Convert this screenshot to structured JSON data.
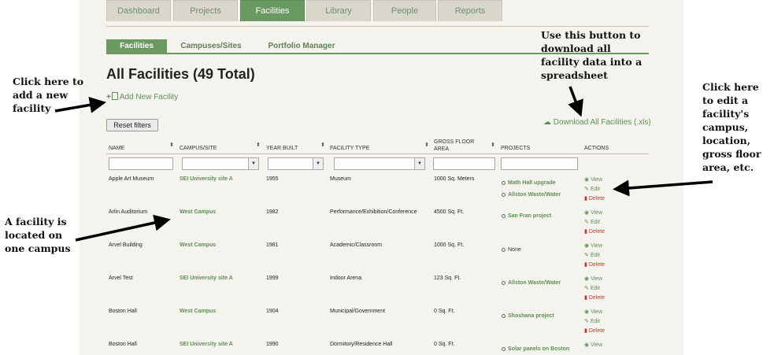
{
  "main_tabs": [
    "Dashboard",
    "Projects",
    "Facilities",
    "Library",
    "People",
    "Reports"
  ],
  "active_main_tab": "Facilities",
  "sub_tabs": [
    "Facilities",
    "Campuses/Sites",
    "Portfolio Manager"
  ],
  "page_title": "All Facilities (49 Total)",
  "add_link": "Add New Facility",
  "reset_button": "Reset filters",
  "download_link": "Download All Facilities (.xls)",
  "columns": [
    "NAME",
    "CAMPUS/SITE",
    "YEAR BUILT",
    "FACILITY TYPE",
    "GROSS FLOOR AREA",
    "PROJECTS",
    "ACTIONS"
  ],
  "actions": {
    "view": "View",
    "edit": "Edit",
    "delete": "Delete"
  },
  "rows": [
    {
      "name": "Apple Art Museum",
      "campus": "SEI University site A",
      "year": "1955",
      "type": "Museum",
      "area": "1000 Sq. Meters",
      "projects": [
        "Math Hall upgrade",
        "Allston Waste/Water"
      ]
    },
    {
      "name": "Arlin Auditorium",
      "campus": "West Campus",
      "year": "1982",
      "type": "Performance/Exhibition/Conference",
      "area": "4500 Sq. Ft.",
      "projects": [
        "San Fran project"
      ]
    },
    {
      "name": "Arvel Building",
      "campus": "West Campus",
      "year": "1981",
      "type": "Academic/Classroom",
      "area": "1000 Sq. Ft.",
      "projects": [
        "None"
      ]
    },
    {
      "name": "Arvel Test",
      "campus": "SEI University site A",
      "year": "1999",
      "type": "Indoor Arena",
      "area": "123 Sq. Ft.",
      "projects": [
        "Allston Waste/Water"
      ]
    },
    {
      "name": "Boston Hall",
      "campus": "West Campus",
      "year": "1904",
      "type": "Municipal/Government",
      "area": "0 Sq. Ft.",
      "projects": [
        "Shoshana project"
      ]
    },
    {
      "name": "Boston Hall",
      "campus": "SEI University site A",
      "year": "1990",
      "type": "Dormitory/Residence Hall",
      "area": "0 Sq. Ft.",
      "projects": [
        "Solar panels on Boston"
      ]
    }
  ],
  "annotations": {
    "add": "Click here to add a new facility",
    "download": "Use this button to download all facility data into a spreadsheet",
    "edit": "Click here to edit a facility's campus, location, gross floor area, etc.",
    "campus": "A facility is located on one campus"
  }
}
